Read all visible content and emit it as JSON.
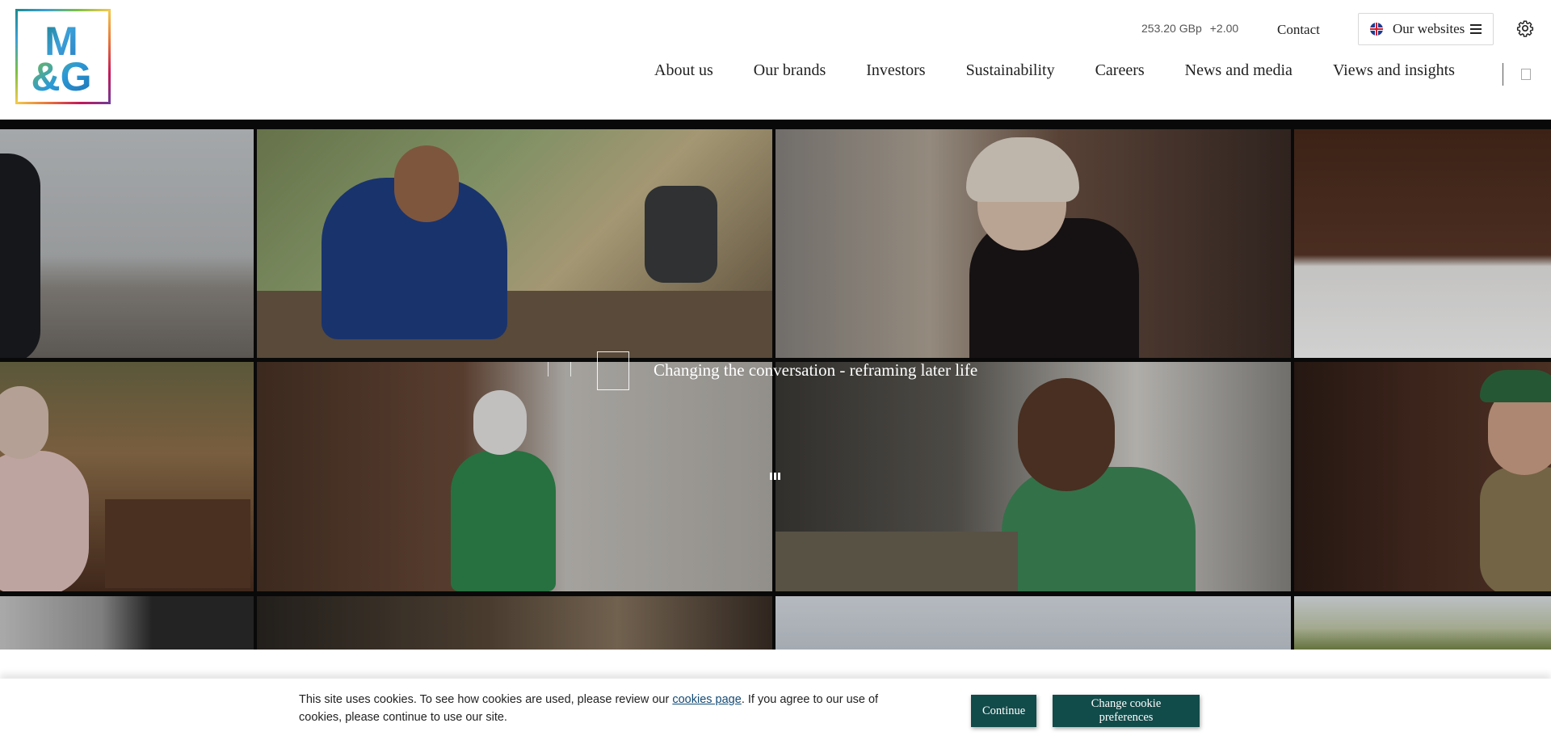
{
  "header": {
    "logo": {
      "line1": "M",
      "line2": "&G"
    },
    "stock": {
      "price": "253.20 GBp",
      "change": "+2.00"
    },
    "contact_label": "Contact",
    "websites": {
      "label": "Our websites",
      "flag_icon": "uk-flag-icon",
      "menu_icon": "hamburger-icon"
    },
    "settings_icon": "gear-icon",
    "nav": [
      {
        "label": "About us"
      },
      {
        "label": "Our brands"
      },
      {
        "label": "Investors"
      },
      {
        "label": "Sustainability"
      },
      {
        "label": "Careers"
      },
      {
        "label": "News and media"
      },
      {
        "label": "Views and insights"
      }
    ],
    "search_icon": "search-icon"
  },
  "hero": {
    "caption": "Changing the conversation - reframing later life",
    "pause_icon": "pause-icon"
  },
  "cookie": {
    "text_before": "This site uses cookies. To see how cookies are used, please review our ",
    "link": "cookies page",
    "text_after": ". If you agree to our use of cookies, please continue to use our site.",
    "continue_label": "Continue",
    "preferences_label": "Change cookie preferences"
  },
  "colors": {
    "button_bg": "#114b4a",
    "link": "#124a74"
  }
}
